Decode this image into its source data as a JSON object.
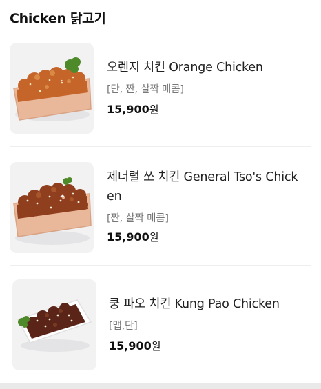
{
  "section": {
    "title": "Chicken 닭고기"
  },
  "items": [
    {
      "name": "오렌지 치킨 Orange Chicken",
      "tags": "[단, 짠, 살짝 매콤]",
      "price": "15,900",
      "currency": "원",
      "image_icon": "orange-chicken-image"
    },
    {
      "name_line1": "제너럴 쏘 치킨 General Tso's Chick",
      "name_line2": "en",
      "tags": "[짠, 살짝 매콤]",
      "price": "15,900",
      "currency": "원",
      "image_icon": "general-tso-chicken-image"
    },
    {
      "name": "쿵 파오 치킨 Kung Pao Chicken",
      "tags": "[맵,단]",
      "price": "15,900",
      "currency": "원",
      "image_icon": "kung-pao-chicken-image"
    }
  ],
  "colors": {
    "tray": "#e9b79a",
    "orange_sauce": "#c5652a",
    "tso_sauce": "#8f3f1e",
    "kungpao_sauce": "#5a2418",
    "broccoli": "#4f8a2a"
  }
}
